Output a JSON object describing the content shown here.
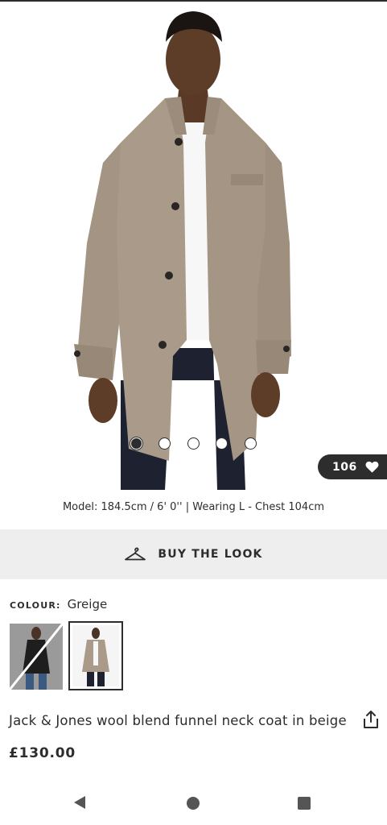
{
  "gallery": {
    "image_alt": "Man wearing beige wool funnel neck coat",
    "slide_count": 5,
    "active_slide": 1
  },
  "saves": {
    "count": "106",
    "icon": "heart-icon"
  },
  "model_info": "Model: 184.5cm / 6' 0'' | Wearing L - Chest 104cm",
  "buy_the_look": {
    "label": "BUY THE LOOK",
    "icon": "hanger-icon"
  },
  "colour": {
    "key": "COLOUR:",
    "value": "Greige",
    "swatches": [
      {
        "name": "black",
        "available": false,
        "selected": false
      },
      {
        "name": "greige",
        "available": true,
        "selected": true
      }
    ]
  },
  "product": {
    "title": "Jack & Jones wool blend funnel neck coat in beige",
    "price": "£130.00",
    "share_icon": "share-icon"
  },
  "navigation": {
    "back_icon": "back-triangle-icon",
    "home_icon": "home-circle-icon",
    "recents_icon": "recents-square-icon"
  },
  "colors": {
    "text": "#2d2d2d",
    "coat": "#a99a89",
    "banner_bg": "#eeeeee"
  }
}
